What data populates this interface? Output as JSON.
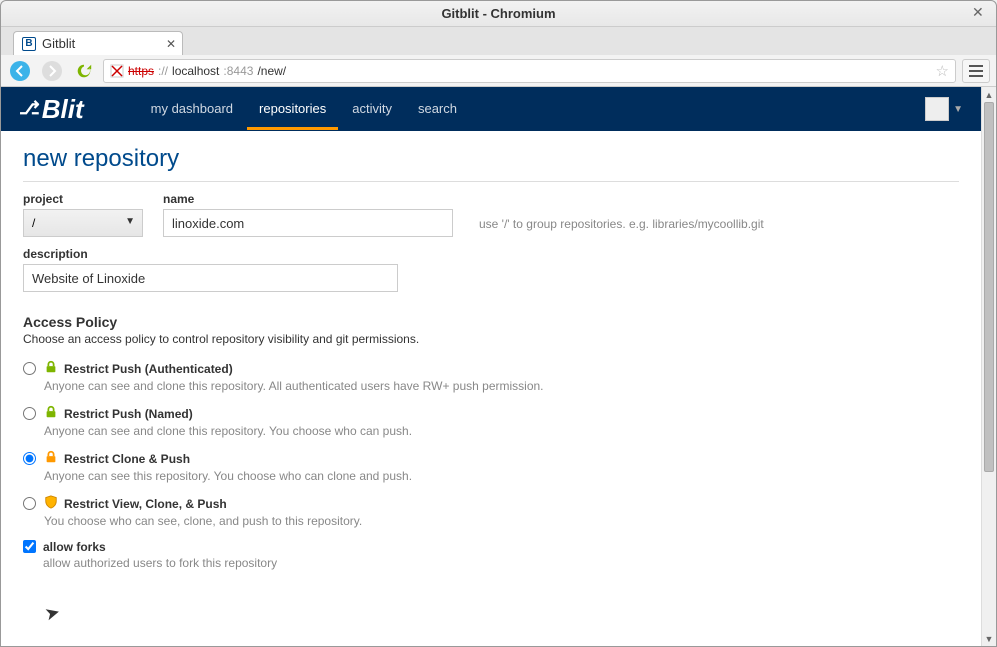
{
  "window": {
    "title": "Gitblit - Chromium"
  },
  "tab": {
    "title": "Gitblit",
    "favicon_text": "B"
  },
  "address": {
    "https_label": "https",
    "host": "localhost",
    "port": ":8443",
    "path": "/new/"
  },
  "navbar": {
    "logo_text": "Blit",
    "links": [
      "my dashboard",
      "repositories",
      "activity",
      "search"
    ],
    "active_index": 1
  },
  "page": {
    "title": "new repository",
    "project_label": "project",
    "project_value": "/",
    "name_label": "name",
    "name_value": "linoxide.com",
    "name_hint": "use '/' to group repositories. e.g. libraries/mycoollib.git",
    "desc_label": "description",
    "desc_value": "Website of Linoxide"
  },
  "access": {
    "title": "Access Policy",
    "desc": "Choose an access policy to control repository visibility and git permissions.",
    "policies": [
      {
        "label": "Restrict Push (Authenticated)",
        "desc": "Anyone can see and clone this repository. All authenticated users have RW+ push permission.",
        "icon": "lock-green"
      },
      {
        "label": "Restrict Push (Named)",
        "desc": "Anyone can see and clone this repository. You choose who can push.",
        "icon": "lock-green"
      },
      {
        "label": "Restrict Clone & Push",
        "desc": "Anyone can see this repository. You choose who can clone and push.",
        "icon": "lock-orange"
      },
      {
        "label": "Restrict View, Clone, & Push",
        "desc": "You choose who can see, clone, and push to this repository.",
        "icon": "shield-orange"
      }
    ],
    "selected_index": 2
  },
  "forks": {
    "label": "allow forks",
    "desc": "allow authorized users to fork this repository",
    "checked": true
  }
}
